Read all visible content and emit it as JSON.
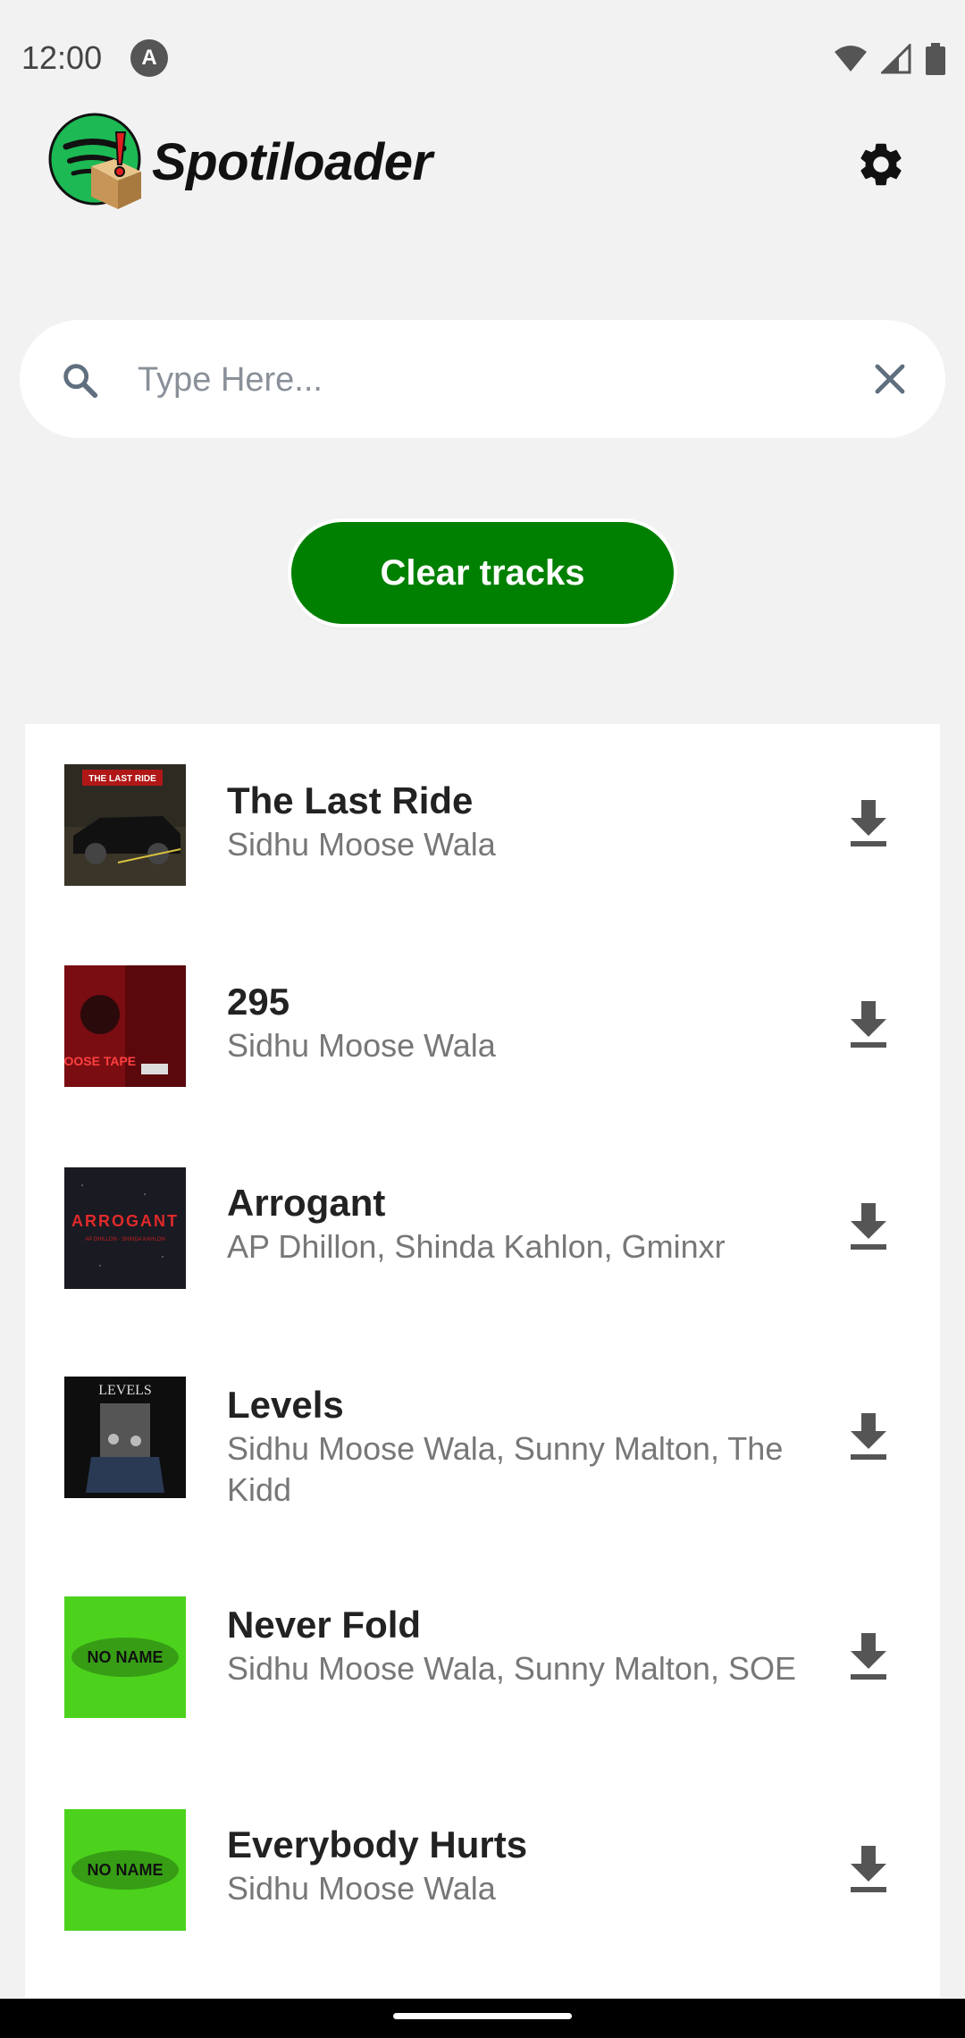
{
  "status_bar": {
    "time": "12:00",
    "a_icon_label": "A"
  },
  "header": {
    "title": "Spotiloader"
  },
  "search": {
    "placeholder": "Type Here...",
    "value": ""
  },
  "actions": {
    "clear_label": "Clear tracks"
  },
  "colors": {
    "accent": "#008000",
    "logo_green": "#1DB954",
    "logo_red": "#e02020"
  },
  "tracks": [
    {
      "title": "The Last Ride",
      "artists": "Sidhu Moose Wala"
    },
    {
      "title": "295",
      "artists": "Sidhu Moose Wala"
    },
    {
      "title": "Arrogant",
      "artists": "AP Dhillon, Shinda Kahlon, Gminxr"
    },
    {
      "title": "Levels",
      "artists": "Sidhu Moose Wala, Sunny Malton, The Kidd"
    },
    {
      "title": "Never Fold",
      "artists": "Sidhu Moose Wala, Sunny Malton, SOE"
    },
    {
      "title": "Everybody Hurts",
      "artists": "Sidhu Moose Wala"
    }
  ],
  "art_text": {
    "last_ride": "THE LAST RIDE",
    "moose_tape": "MOOSE TAPE",
    "arrogant": "ARROGANT",
    "arrogant_sub": "AP DHILLON · SHINDA KAHLON",
    "levels": "LEVELS",
    "no_name": "NO NAME"
  }
}
